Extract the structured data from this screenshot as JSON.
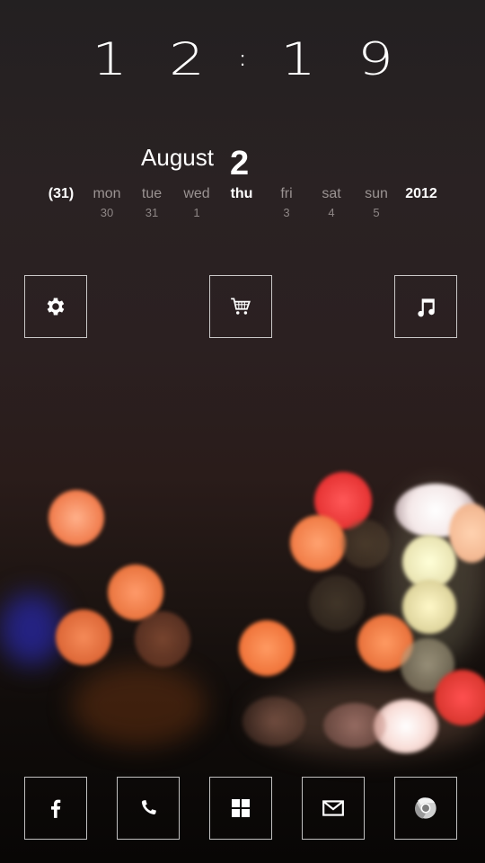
{
  "clock": {
    "h1": "1",
    "h2": "2",
    "separator": ":",
    "m1": "1",
    "m2": "9"
  },
  "date": {
    "month": "August",
    "day": "2"
  },
  "week": [
    {
      "name": "(31)",
      "num": "",
      "style": "bold"
    },
    {
      "name": "mon",
      "num": "30",
      "style": "normal"
    },
    {
      "name": "tue",
      "num": "31",
      "style": "normal"
    },
    {
      "name": "wed",
      "num": "1",
      "style": "normal"
    },
    {
      "name": "thu",
      "num": "",
      "style": "today"
    },
    {
      "name": "fri",
      "num": "3",
      "style": "normal"
    },
    {
      "name": "sat",
      "num": "4",
      "style": "normal"
    },
    {
      "name": "sun",
      "num": "5",
      "style": "normal"
    },
    {
      "name": "2012",
      "num": "",
      "style": "bold"
    }
  ],
  "top_tiles": [
    {
      "icon": "gear-icon"
    },
    {
      "icon": "shopping-cart-icon"
    },
    {
      "icon": "music-note-icon"
    }
  ],
  "dock_tiles": [
    {
      "icon": "facebook-icon"
    },
    {
      "icon": "phone-icon"
    },
    {
      "icon": "windows-icon"
    },
    {
      "icon": "mail-icon"
    },
    {
      "icon": "chrome-icon"
    }
  ],
  "colors": {
    "text": "#ffffff",
    "muted_text": "#9a9392",
    "tile_border": "#ffffff"
  }
}
